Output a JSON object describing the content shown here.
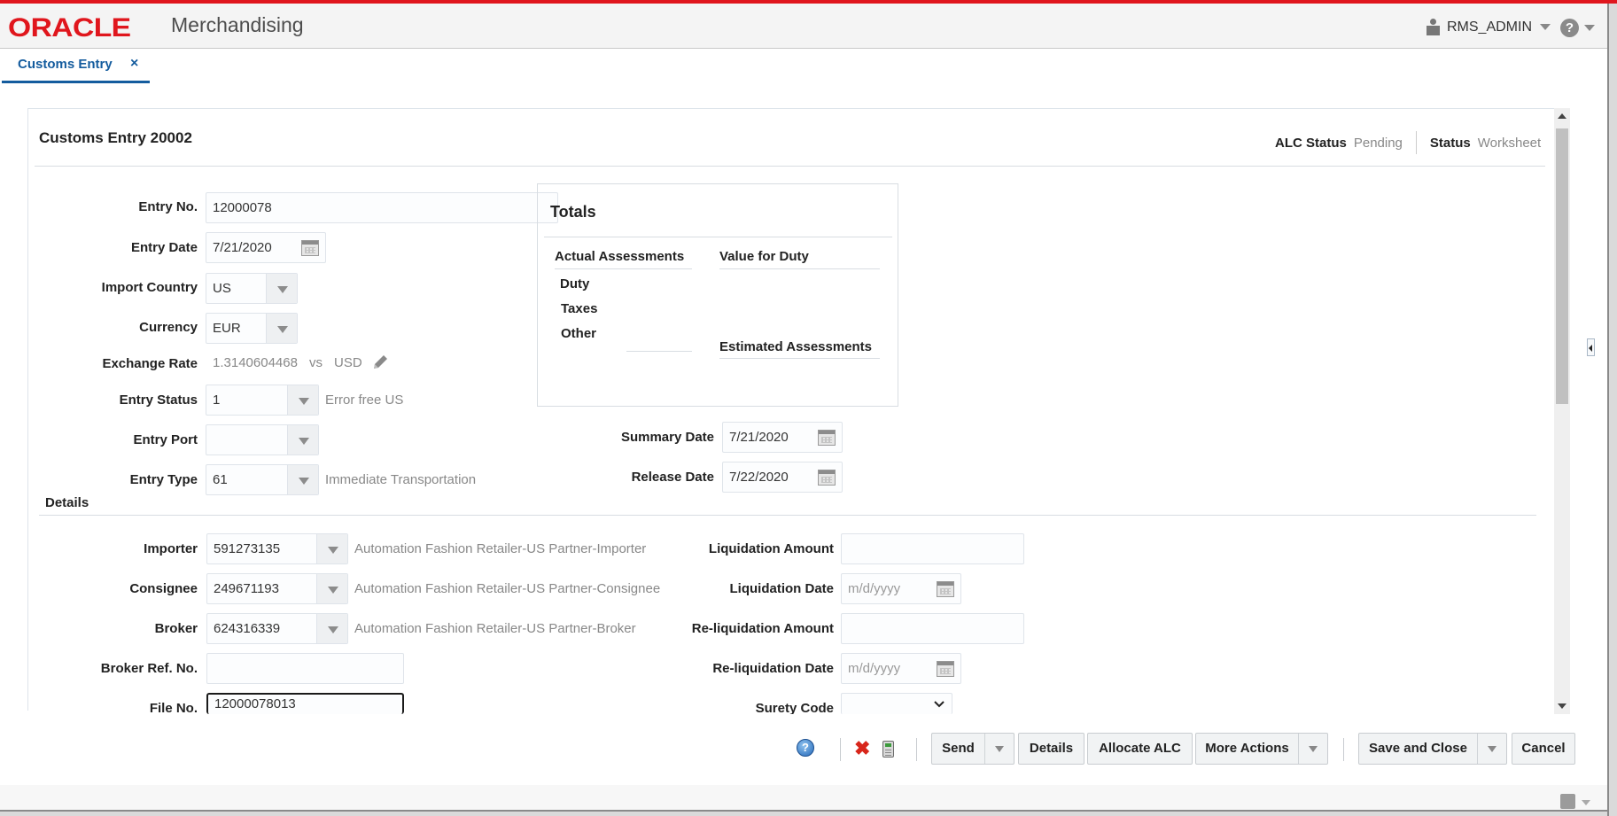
{
  "header": {
    "brand": "ORACLE",
    "app_name": "Merchandising",
    "user": "RMS_ADMIN",
    "help_icon": "help-icon"
  },
  "tabs": [
    {
      "label": "Customs Entry",
      "close": "×",
      "active": true
    }
  ],
  "page": {
    "title": "Customs Entry 20002",
    "alc_status_label": "ALC Status",
    "alc_status_value": "Pending",
    "status_label": "Status",
    "status_value": "Worksheet"
  },
  "form": {
    "entry_no": {
      "label": "Entry No.",
      "value": "12000078"
    },
    "entry_date": {
      "label": "Entry Date",
      "value": "7/21/2020"
    },
    "import_country": {
      "label": "Import Country",
      "value": "US"
    },
    "currency": {
      "label": "Currency",
      "value": "EUR"
    },
    "exchange_rate": {
      "label": "Exchange Rate",
      "value": "1.3140604468",
      "vs": "vs",
      "vs_currency": "USD"
    },
    "entry_status": {
      "label": "Entry Status",
      "value": "1",
      "description": "Error free US"
    },
    "entry_port": {
      "label": "Entry Port",
      "value": ""
    },
    "entry_type": {
      "label": "Entry Type",
      "value": "61",
      "description": "Immediate Transportation"
    },
    "summary_date": {
      "label": "Summary Date",
      "value": "7/21/2020"
    },
    "release_date": {
      "label": "Release Date",
      "value": "7/22/2020"
    }
  },
  "totals": {
    "title": "Totals",
    "actual_assessments": "Actual Assessments",
    "duty": "Duty",
    "taxes": "Taxes",
    "other": "Other",
    "value_for_duty": "Value for Duty",
    "estimated_assessments": "Estimated Assessments"
  },
  "details": {
    "section_label": "Details",
    "importer": {
      "label": "Importer",
      "value": "591273135",
      "description": "Automation Fashion Retailer-US Partner-Importer"
    },
    "consignee": {
      "label": "Consignee",
      "value": "249671193",
      "description": "Automation Fashion Retailer-US Partner-Consignee"
    },
    "broker": {
      "label": "Broker",
      "value": "624316339",
      "description": "Automation Fashion Retailer-US Partner-Broker"
    },
    "broker_ref_no": {
      "label": "Broker Ref. No.",
      "value": ""
    },
    "file_no": {
      "label": "File No.",
      "value": "12000078013"
    },
    "liquidation_amount": {
      "label": "Liquidation Amount",
      "value": ""
    },
    "liquidation_date": {
      "label": "Liquidation Date",
      "placeholder": "m/d/yyyy"
    },
    "reliquidation_amount": {
      "label": "Re-liquidation Amount",
      "value": ""
    },
    "reliquidation_date": {
      "label": "Re-liquidation Date",
      "placeholder": "m/d/yyyy"
    },
    "surety_code": {
      "label": "Surety Code",
      "value": ""
    }
  },
  "footer": {
    "help": "?",
    "send": "Send",
    "details": "Details",
    "allocate_alc": "Allocate ALC",
    "more_actions": "More Actions",
    "save_and_close": "Save and Close",
    "cancel": "Cancel"
  }
}
